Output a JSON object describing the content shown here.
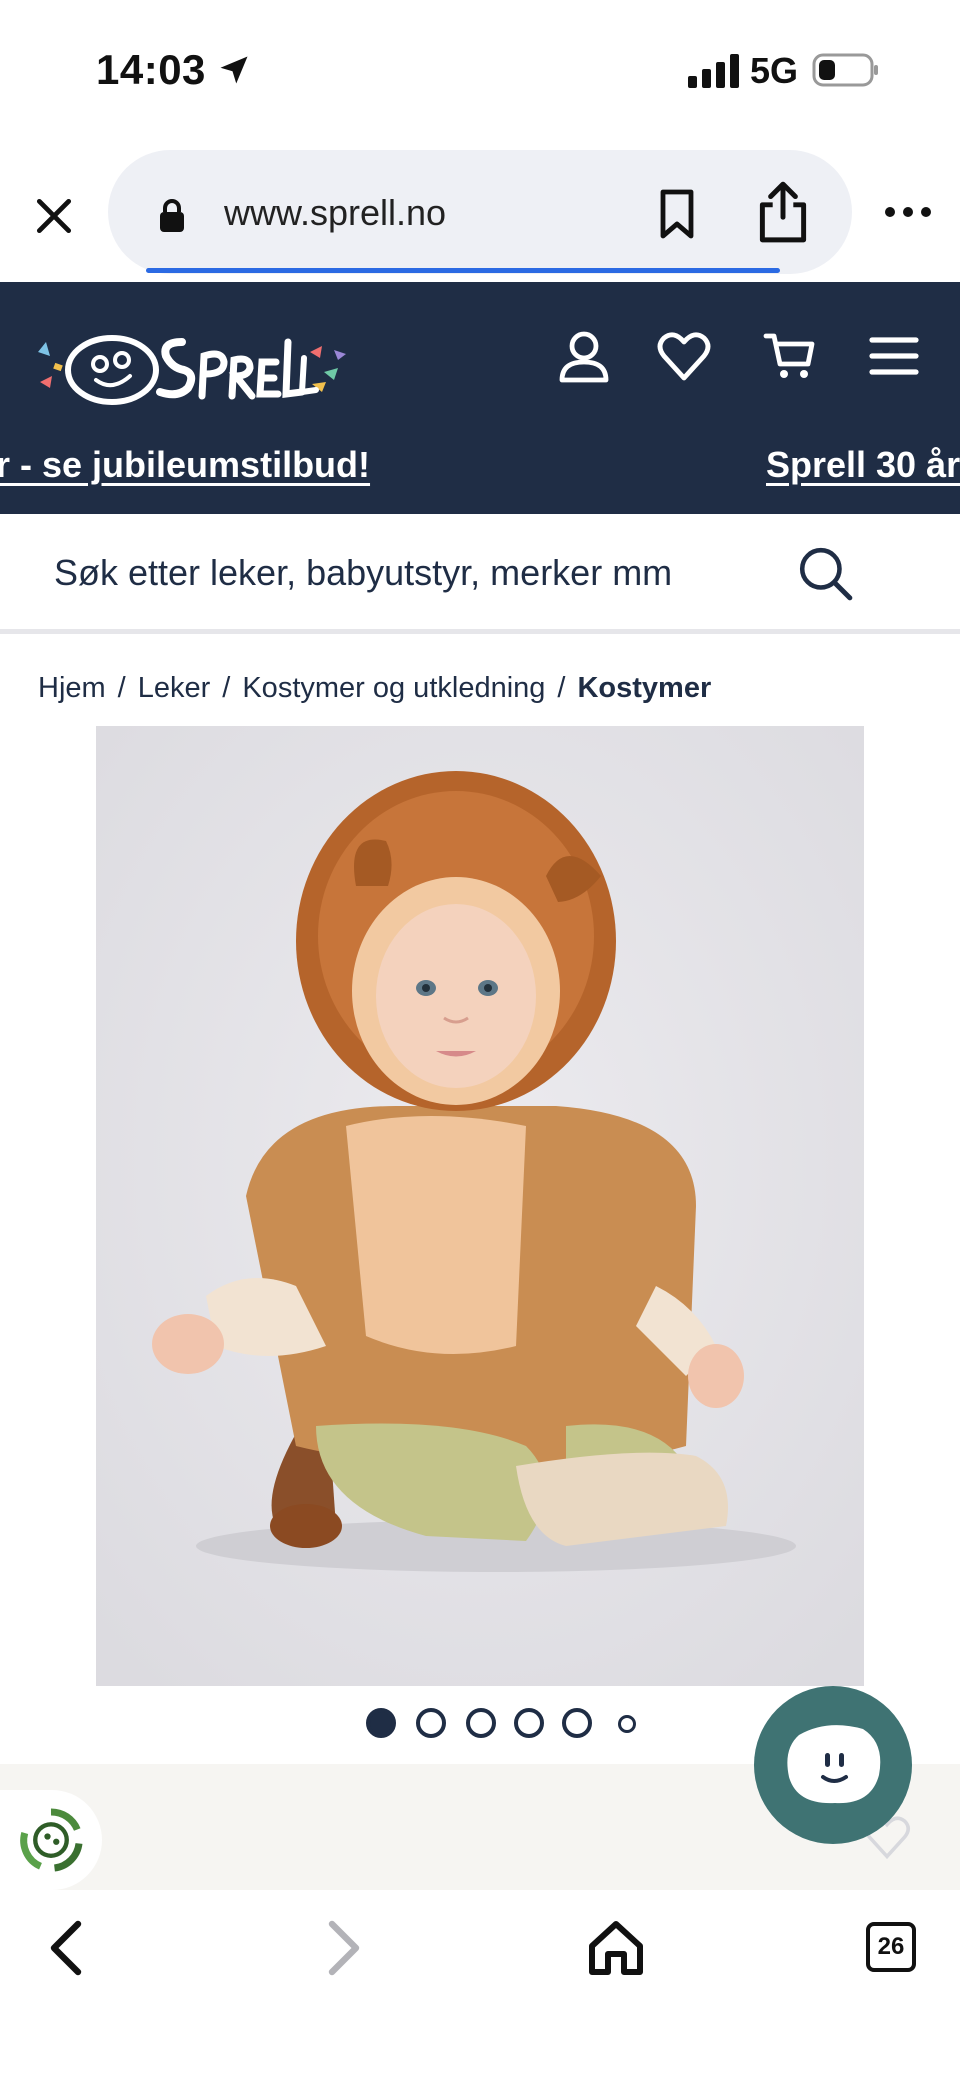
{
  "status_bar": {
    "time": "14:03",
    "network": "5G"
  },
  "browser": {
    "url": "www.sprell.no",
    "tabs_count": "26",
    "page_load_progress": 0.9
  },
  "site": {
    "brand_name": "Sprell",
    "banner_links": [
      "r - se jubileumstilbud!",
      "Sprell 30 år"
    ],
    "search_placeholder": "Søk etter leker, babyutstyr, merker mm",
    "breadcrumb": [
      "Hjem",
      "Leker",
      "Kostymer og utkledning",
      "Kostymer"
    ],
    "image_carousel": {
      "total": 6,
      "active_index": 0
    }
  },
  "colors": {
    "header_bg": "#1f2d45",
    "chat_bg": "#3f7373",
    "accent_blue": "#2b6ae3"
  },
  "icons": [
    "location-arrow-icon",
    "signal-icon",
    "battery-icon",
    "close-icon",
    "lock-icon",
    "bookmark-icon",
    "share-icon",
    "more-icon",
    "account-icon",
    "heart-icon",
    "cart-icon",
    "menu-icon",
    "search-icon",
    "chat-icon",
    "eco-icon",
    "back-icon",
    "forward-icon",
    "home-icon",
    "tabs-icon"
  ]
}
